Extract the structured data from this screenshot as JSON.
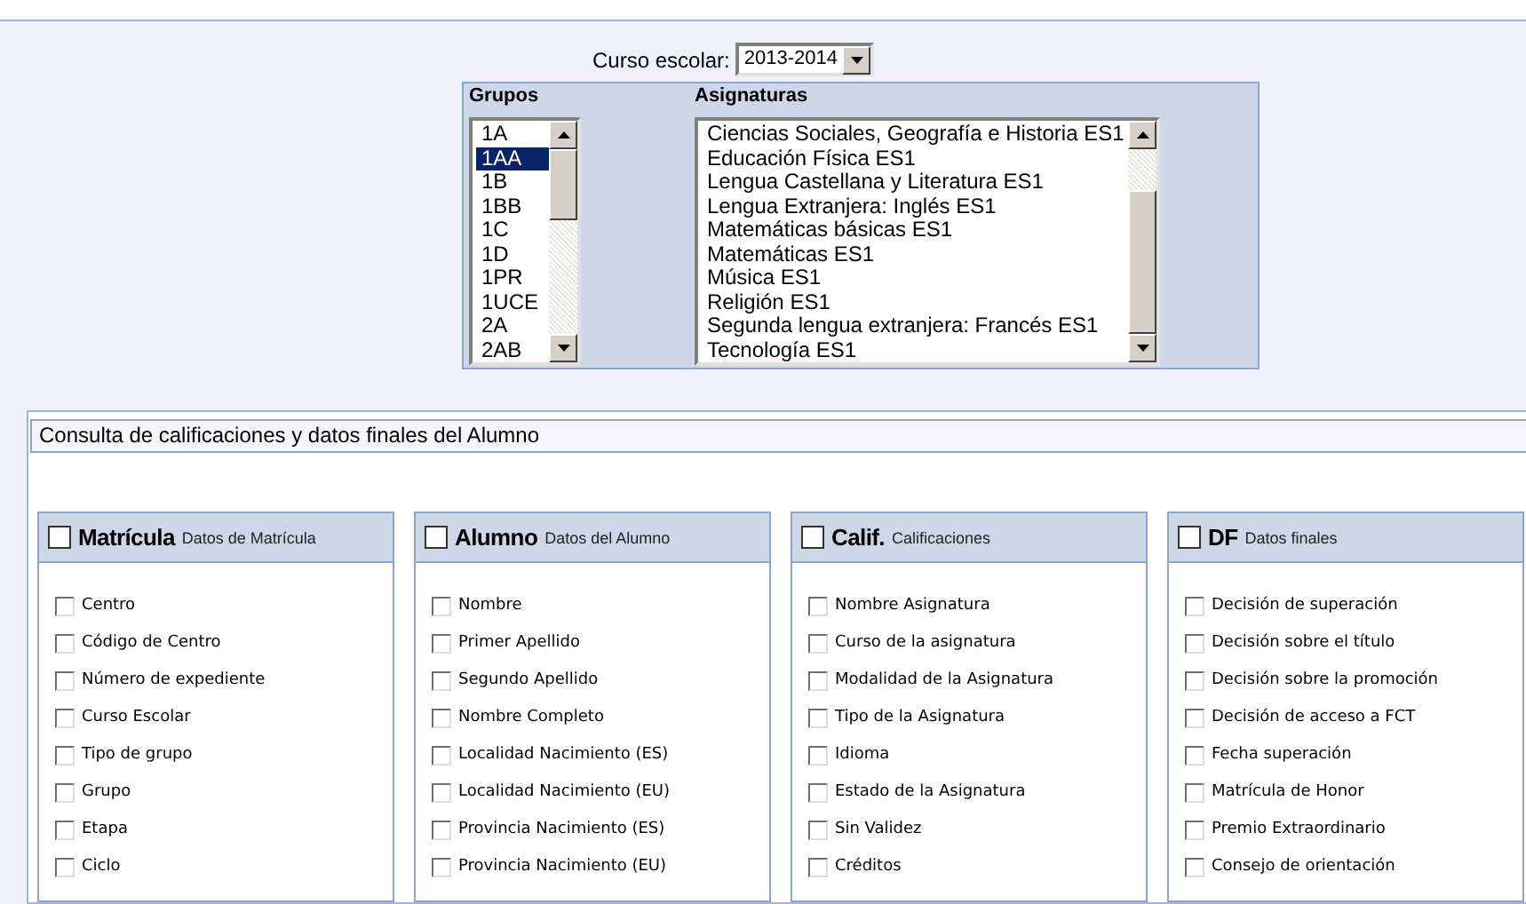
{
  "school_year": {
    "label": "Curso escolar:",
    "value": "2013-2014"
  },
  "groups": {
    "title": "Grupos",
    "items": [
      {
        "label": "1A",
        "selected": false
      },
      {
        "label": "1AA",
        "selected": true
      },
      {
        "label": "1B",
        "selected": false
      },
      {
        "label": "1BB",
        "selected": false
      },
      {
        "label": "1C",
        "selected": false
      },
      {
        "label": "1D",
        "selected": false
      },
      {
        "label": "1PR",
        "selected": false
      },
      {
        "label": "1UCE",
        "selected": false
      },
      {
        "label": "2A",
        "selected": false
      },
      {
        "label": "2AB",
        "selected": false
      }
    ]
  },
  "subjects": {
    "title": "Asignaturas",
    "items": [
      {
        "label": "Ciencias Sociales, Geografía e Historia ES1",
        "selected": false
      },
      {
        "label": "Educación Física ES1",
        "selected": false
      },
      {
        "label": "Lengua Castellana y Literatura ES1",
        "selected": false
      },
      {
        "label": "Lengua Extranjera: Inglés ES1",
        "selected": false
      },
      {
        "label": "Matemáticas básicas ES1",
        "selected": false
      },
      {
        "label": "Matemáticas ES1",
        "selected": false
      },
      {
        "label": "Música ES1",
        "selected": false
      },
      {
        "label": "Religión ES1",
        "selected": false
      },
      {
        "label": "Segunda lengua extranjera: Francés ES1",
        "selected": false
      },
      {
        "label": "Tecnología ES1",
        "selected": false
      }
    ]
  },
  "panel": {
    "title": "Consulta de calificaciones y datos finales del Alumno",
    "sections": [
      {
        "name": "Matrícula",
        "subtitle": "Datos de Matrícula",
        "checked": false,
        "fields": [
          {
            "label": "Centro",
            "checked": false
          },
          {
            "label": "Código de Centro",
            "checked": false
          },
          {
            "label": "Número de expediente",
            "checked": false
          },
          {
            "label": "Curso Escolar",
            "checked": false
          },
          {
            "label": "Tipo de grupo",
            "checked": false
          },
          {
            "label": "Grupo",
            "checked": false
          },
          {
            "label": "Etapa",
            "checked": false
          },
          {
            "label": "Ciclo",
            "checked": false
          }
        ]
      },
      {
        "name": "Alumno",
        "subtitle": "Datos del Alumno",
        "checked": false,
        "fields": [
          {
            "label": "Nombre",
            "checked": false
          },
          {
            "label": "Primer Apellido",
            "checked": false
          },
          {
            "label": "Segundo Apellido",
            "checked": false
          },
          {
            "label": "Nombre Completo",
            "checked": false
          },
          {
            "label": "Localidad Nacimiento (ES)",
            "checked": false
          },
          {
            "label": "Localidad Nacimiento (EU)",
            "checked": false
          },
          {
            "label": "Provincia Nacimiento (ES)",
            "checked": false
          },
          {
            "label": "Provincia Nacimiento (EU)",
            "checked": false
          }
        ]
      },
      {
        "name": "Calif.",
        "subtitle": "Calificaciones",
        "checked": false,
        "fields": [
          {
            "label": "Nombre Asignatura",
            "checked": false
          },
          {
            "label": "Curso de la asignatura",
            "checked": false
          },
          {
            "label": "Modalidad de la Asignatura",
            "checked": false
          },
          {
            "label": "Tipo de la Asignatura",
            "checked": false
          },
          {
            "label": "Idioma",
            "checked": false
          },
          {
            "label": "Estado de la Asignatura",
            "checked": false
          },
          {
            "label": "Sin Validez",
            "checked": false
          },
          {
            "label": "Créditos",
            "checked": false
          }
        ]
      },
      {
        "name": "DF",
        "subtitle": "Datos finales",
        "checked": false,
        "fields": [
          {
            "label": "Decisión de superación",
            "checked": false
          },
          {
            "label": "Decisión sobre el título",
            "checked": false
          },
          {
            "label": "Decisión sobre la promoción",
            "checked": false
          },
          {
            "label": "Decisión de acceso a FCT",
            "checked": false
          },
          {
            "label": "Fecha superación",
            "checked": false
          },
          {
            "label": "Matrícula de Honor",
            "checked": false
          },
          {
            "label": "Premio Extraordinario",
            "checked": false
          },
          {
            "label": "Consejo de orientación",
            "checked": false
          }
        ]
      }
    ]
  }
}
